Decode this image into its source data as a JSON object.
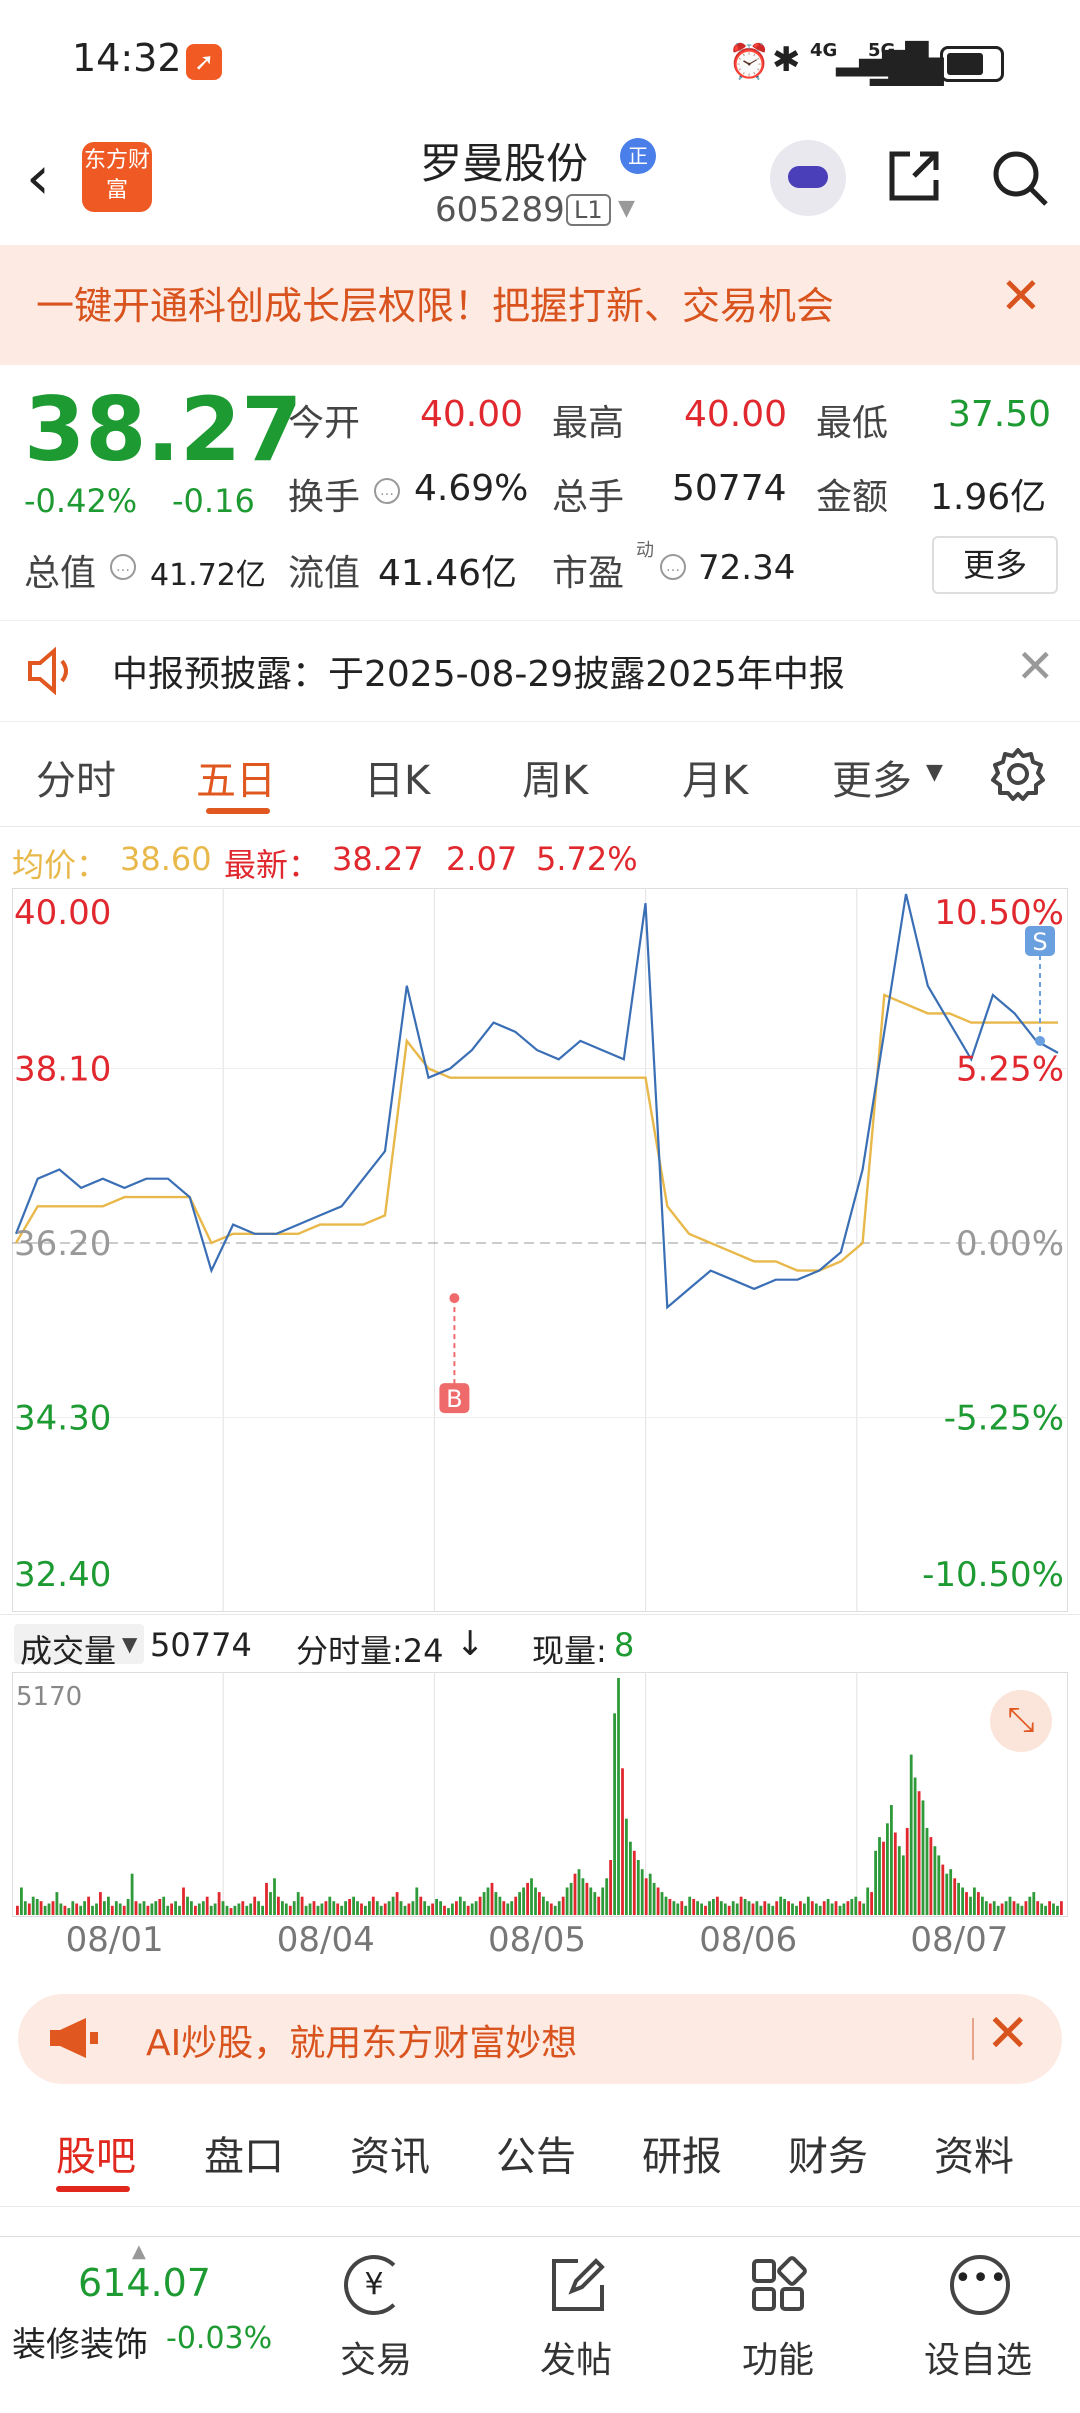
{
  "status": {
    "time": "14:32",
    "net1": "4G",
    "net2": "5G"
  },
  "header": {
    "logo_text": "东方财富",
    "stock_name": "罗曼股份",
    "badge": "正",
    "code": "605289",
    "level": "L1"
  },
  "banner": {
    "text": "一键开通科创成长层权限！把握打新、交易机会"
  },
  "quote": {
    "price": "38.27",
    "change_pct": "-0.42%",
    "change": "-0.16",
    "open_label": "今开",
    "open": "40.00",
    "high_label": "最高",
    "high": "40.00",
    "low_label": "最低",
    "low": "37.50",
    "turnover_label": "换手",
    "turnover": "4.69%",
    "volume_label": "总手",
    "volume": "50774",
    "amount_label": "金额",
    "amount": "1.96亿",
    "mktcap_label": "总值",
    "mktcap": "41.72亿",
    "float_label": "流值",
    "float": "41.46亿",
    "pe_label": "市盈",
    "pe_sup": "动",
    "pe": "72.34",
    "more": "更多"
  },
  "notice": {
    "text": "中报预披露：于2025-08-29披露2025年中报"
  },
  "tabs": [
    "分时",
    "五日",
    "日K",
    "周K",
    "月K",
    "更多"
  ],
  "legend": {
    "avg_label": "均价：",
    "avg": "38.60",
    "latest_label": "最新：",
    "latest": "38.27",
    "chg": "2.07",
    "pct": "5.72%"
  },
  "chart_data": {
    "type": "line",
    "title": "",
    "y_left_ticks": [
      "40.00",
      "38.10",
      "36.20",
      "34.30",
      "32.40"
    ],
    "y_right_ticks": [
      "10.50%",
      "5.25%",
      "0.00%",
      "-5.25%",
      "-10.50%"
    ],
    "ylim": [
      32.4,
      40.0
    ],
    "prev_close": 36.2,
    "days": [
      "08/01",
      "08/04",
      "08/05",
      "08/06",
      "08/07"
    ],
    "series": [
      {
        "name": "",
        "color": "#3a6fb5",
        "values": [
          36.3,
          36.9,
          37.0,
          36.8,
          36.9,
          36.8,
          36.9,
          36.9,
          36.7,
          35.9,
          36.4,
          36.3,
          36.3,
          36.4,
          36.5,
          36.6,
          36.9,
          37.2,
          39.0,
          38.0,
          38.1,
          38.3,
          38.6,
          38.5,
          38.3,
          38.2,
          38.4,
          38.3,
          38.2,
          39.9,
          35.5,
          35.7,
          35.9,
          35.8,
          35.7,
          35.8,
          35.8,
          35.9,
          36.1,
          37.0,
          38.5,
          40.0,
          39.0,
          38.6,
          38.2,
          38.9,
          38.7,
          38.4,
          38.27
        ]
      },
      {
        "name": "",
        "color": "#e8b84a",
        "values": [
          36.2,
          36.6,
          36.6,
          36.6,
          36.6,
          36.7,
          36.7,
          36.7,
          36.7,
          36.2,
          36.3,
          36.3,
          36.3,
          36.3,
          36.4,
          36.4,
          36.4,
          36.5,
          38.4,
          38.1,
          38.0,
          38.0,
          38.0,
          38.0,
          38.0,
          38.0,
          38.0,
          38.0,
          38.0,
          38.0,
          36.6,
          36.3,
          36.2,
          36.1,
          36.0,
          36.0,
          35.9,
          35.9,
          36.0,
          36.2,
          38.9,
          38.8,
          38.7,
          38.7,
          38.6,
          38.6,
          38.6,
          38.6,
          38.6
        ]
      }
    ],
    "markers": [
      {
        "label": "B",
        "day": "08/05",
        "value": 35.6
      },
      {
        "label": "S",
        "day": "08/07",
        "value": 38.4
      }
    ]
  },
  "volume": {
    "label": "成交量",
    "total": "50774",
    "tick_label": "分时量:24",
    "tick_arrow": "↓",
    "now_label": "现量:",
    "now": "8",
    "ymax": "5170",
    "bars": [
      200,
      600,
      300,
      250,
      400,
      350,
      300,
      200,
      250,
      300,
      500,
      250,
      200,
      150,
      300,
      250,
      200,
      300,
      400,
      200,
      250,
      500,
      300,
      400,
      200,
      300,
      250,
      200,
      350,
      900,
      300,
      250,
      300,
      200,
      250,
      300,
      350,
      400,
      200,
      250,
      300,
      200,
      600,
      400,
      300,
      200,
      250,
      300,
      400,
      200,
      250,
      500,
      300,
      200,
      150,
      200,
      250,
      300,
      200,
      250,
      400,
      300,
      200,
      700,
      500,
      800,
      400,
      300,
      250,
      200,
      300,
      500,
      400,
      200,
      250,
      300,
      200,
      250,
      300,
      400,
      300,
      250,
      200,
      300,
      350,
      400,
      300,
      250,
      200,
      300,
      400,
      300,
      200,
      250,
      300,
      400,
      500,
      300,
      200,
      250,
      300,
      600,
      400,
      300,
      200,
      250,
      350,
      300,
      200,
      150,
      250,
      300,
      400,
      300,
      200,
      250,
      300,
      400,
      500,
      600,
      700,
      500,
      400,
      300,
      250,
      300,
      400,
      500,
      600,
      700,
      800,
      600,
      500,
      400,
      300,
      250,
      200,
      300,
      400,
      600,
      700,
      900,
      1000,
      800,
      700,
      600,
      500,
      400,
      600,
      800,
      1200,
      4400,
      5170,
      3200,
      2100,
      1600,
      1400,
      1200,
      1000,
      800,
      900,
      700,
      600,
      500,
      400,
      350,
      300,
      250,
      300,
      200,
      400,
      350,
      300,
      250,
      200,
      300,
      350,
      400,
      300,
      250,
      200,
      300,
      250,
      400,
      350,
      300,
      250,
      300,
      200,
      300,
      250,
      200,
      300,
      400,
      350,
      300,
      250,
      200,
      300,
      250,
      400,
      300,
      250,
      200,
      300,
      350,
      250,
      300,
      200,
      250,
      300,
      350,
      400,
      300,
      250,
      600,
      500,
      1400,
      1700,
      1600,
      2000,
      2400,
      1800,
      1500,
      1300,
      1900,
      3500,
      3000,
      2700,
      2500,
      1900,
      1700,
      1500,
      1300,
      1100,
      900,
      1000,
      800,
      700,
      600,
      500,
      400,
      600,
      500,
      400,
      300,
      250,
      300,
      200,
      250,
      300,
      400,
      300,
      250,
      200,
      300,
      400,
      500,
      300,
      250,
      200,
      300,
      250,
      200,
      300
    ]
  },
  "ai_banner": {
    "text": "AI炒股，就用东方财富妙想"
  },
  "bottom_tabs": [
    "股吧",
    "盘口",
    "资讯",
    "公告",
    "研报",
    "财务",
    "资料"
  ],
  "footer": {
    "index_value": "614.07",
    "index_name": "装修装饰",
    "index_pct": "-0.03%",
    "items": [
      "交易",
      "发帖",
      "功能",
      "设自选"
    ]
  }
}
